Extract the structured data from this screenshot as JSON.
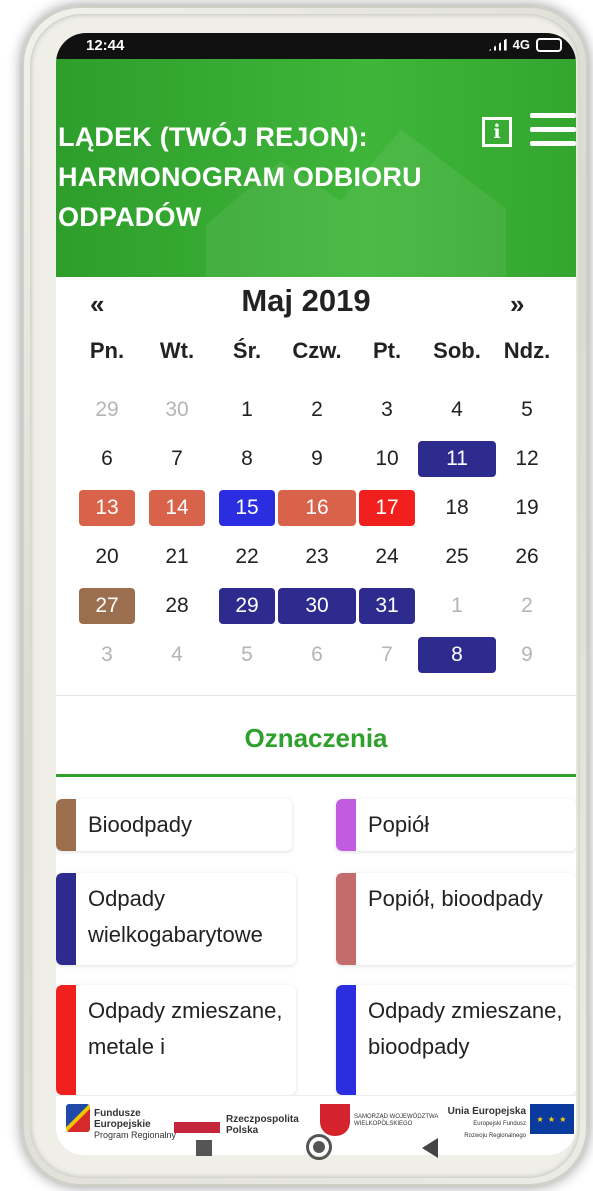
{
  "status_bar": {
    "time": "12:44",
    "network": "4G"
  },
  "header": {
    "title": "LĄDEK (TWÓJ REJON): HARMONOGRAM ODBIORU ODPADÓW"
  },
  "calendar": {
    "prev": "«",
    "next": "»",
    "month_title": "Maj 2019",
    "weekdays": [
      "Pn.",
      "Wt.",
      "Śr.",
      "Czw.",
      "Pt.",
      "Sob.",
      "Ndz."
    ],
    "weeks": [
      [
        {
          "d": "29",
          "muted": true
        },
        {
          "d": "30",
          "muted": true
        },
        {
          "d": "1"
        },
        {
          "d": "2"
        },
        {
          "d": "3"
        },
        {
          "d": "4"
        },
        {
          "d": "5"
        }
      ],
      [
        {
          "d": "6"
        },
        {
          "d": "7"
        },
        {
          "d": "8"
        },
        {
          "d": "9"
        },
        {
          "d": "10"
        },
        {
          "d": "11",
          "color": "#2e2b8f"
        },
        {
          "d": "12"
        }
      ],
      [
        {
          "d": "13",
          "color": "#d9634a"
        },
        {
          "d": "14",
          "color": "#d9634a"
        },
        {
          "d": "15",
          "color": "#2a2de0"
        },
        {
          "d": "16",
          "color": "#d9634a"
        },
        {
          "d": "17",
          "color": "#f21f1f"
        },
        {
          "d": "18"
        },
        {
          "d": "19"
        }
      ],
      [
        {
          "d": "20"
        },
        {
          "d": "21"
        },
        {
          "d": "22"
        },
        {
          "d": "23"
        },
        {
          "d": "24"
        },
        {
          "d": "25"
        },
        {
          "d": "26"
        }
      ],
      [
        {
          "d": "27",
          "color": "#9b6e4e"
        },
        {
          "d": "28"
        },
        {
          "d": "29",
          "color": "#2e2b8f"
        },
        {
          "d": "30",
          "color": "#2e2b8f"
        },
        {
          "d": "31",
          "color": "#2e2b8f"
        },
        {
          "d": "1",
          "muted": true
        },
        {
          "d": "2",
          "muted": true
        }
      ],
      [
        {
          "d": "3",
          "muted": true
        },
        {
          "d": "4",
          "muted": true
        },
        {
          "d": "5",
          "muted": true
        },
        {
          "d": "6",
          "muted": true
        },
        {
          "d": "7",
          "muted": true
        },
        {
          "d": "8",
          "color": "#2e2b8f"
        },
        {
          "d": "9",
          "muted": true
        }
      ]
    ]
  },
  "legend": {
    "title": "Oznaczenia",
    "items": [
      {
        "label": "Bioodpady",
        "color": "#9b6e4e"
      },
      {
        "label": "Popiół",
        "color": "#c15be0"
      },
      {
        "label": "Odpady wielkogabarytowe",
        "color": "#2e2b8f"
      },
      {
        "label": "Popiół, bioodpady",
        "color": "#c46c6c"
      },
      {
        "label": "Odpady zmieszane, metale i",
        "color": "#f21f1f"
      },
      {
        "label": "Odpady zmieszane, bioodpady",
        "color": "#2a2de0"
      }
    ]
  },
  "footer": {
    "logo1": {
      "line1": "Fundusze",
      "line2": "Europejskie",
      "line3": "Program Regionalny"
    },
    "logo2": {
      "line1": "Rzeczpospolita",
      "line2": "Polska"
    },
    "logo3": {
      "line1": "SAMORZĄD WOJEWÓDZTWA",
      "line2": "WIELKOPOLSKIEGO"
    },
    "logo4": {
      "line1": "Unia Europejska",
      "line2": "Europejski Fundusz",
      "line3": "Rozwoju Regionalnego"
    }
  }
}
